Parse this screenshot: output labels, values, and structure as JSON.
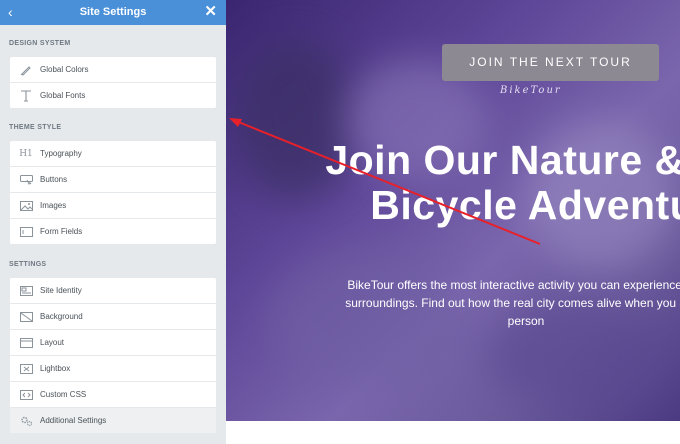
{
  "sidebar": {
    "title": "Site Settings",
    "back_icon": "chevron-left-icon",
    "close_icon": "close-icon",
    "sections": [
      {
        "heading": "DESIGN SYSTEM",
        "items": [
          {
            "label": "Global Colors",
            "icon": "brush-icon"
          },
          {
            "label": "Global Fonts",
            "icon": "text-icon"
          }
        ]
      },
      {
        "heading": "THEME STYLE",
        "items": [
          {
            "label": "Typography",
            "icon": "heading-icon"
          },
          {
            "label": "Buttons",
            "icon": "button-icon"
          },
          {
            "label": "Images",
            "icon": "image-icon"
          },
          {
            "label": "Form Fields",
            "icon": "form-icon"
          }
        ]
      },
      {
        "heading": "SETTINGS",
        "items": [
          {
            "label": "Site Identity",
            "icon": "site-identity-icon"
          },
          {
            "label": "Background",
            "icon": "background-icon"
          },
          {
            "label": "Layout",
            "icon": "layout-icon"
          },
          {
            "label": "Lightbox",
            "icon": "lightbox-icon"
          },
          {
            "label": "Custom CSS",
            "icon": "code-icon"
          },
          {
            "label": "Additional Settings",
            "icon": "gears-icon"
          }
        ]
      }
    ]
  },
  "preview": {
    "cta_label": "JOIN THE NEXT TOUR",
    "brand": "BikeTour",
    "headline_line1": "Join Our Nature & U",
    "headline_line2": "Bicycle Adventur",
    "paragraph_line1": "BikeTour offers the most interactive activity you can experience in u",
    "paragraph_line2": "surroundings. Find out how the real city comes alive when you are g",
    "paragraph_line3": "person"
  },
  "colors": {
    "header_blue": "#4a90d9",
    "hero_purple": "#5e4698",
    "annotation_red": "#e8202a"
  }
}
